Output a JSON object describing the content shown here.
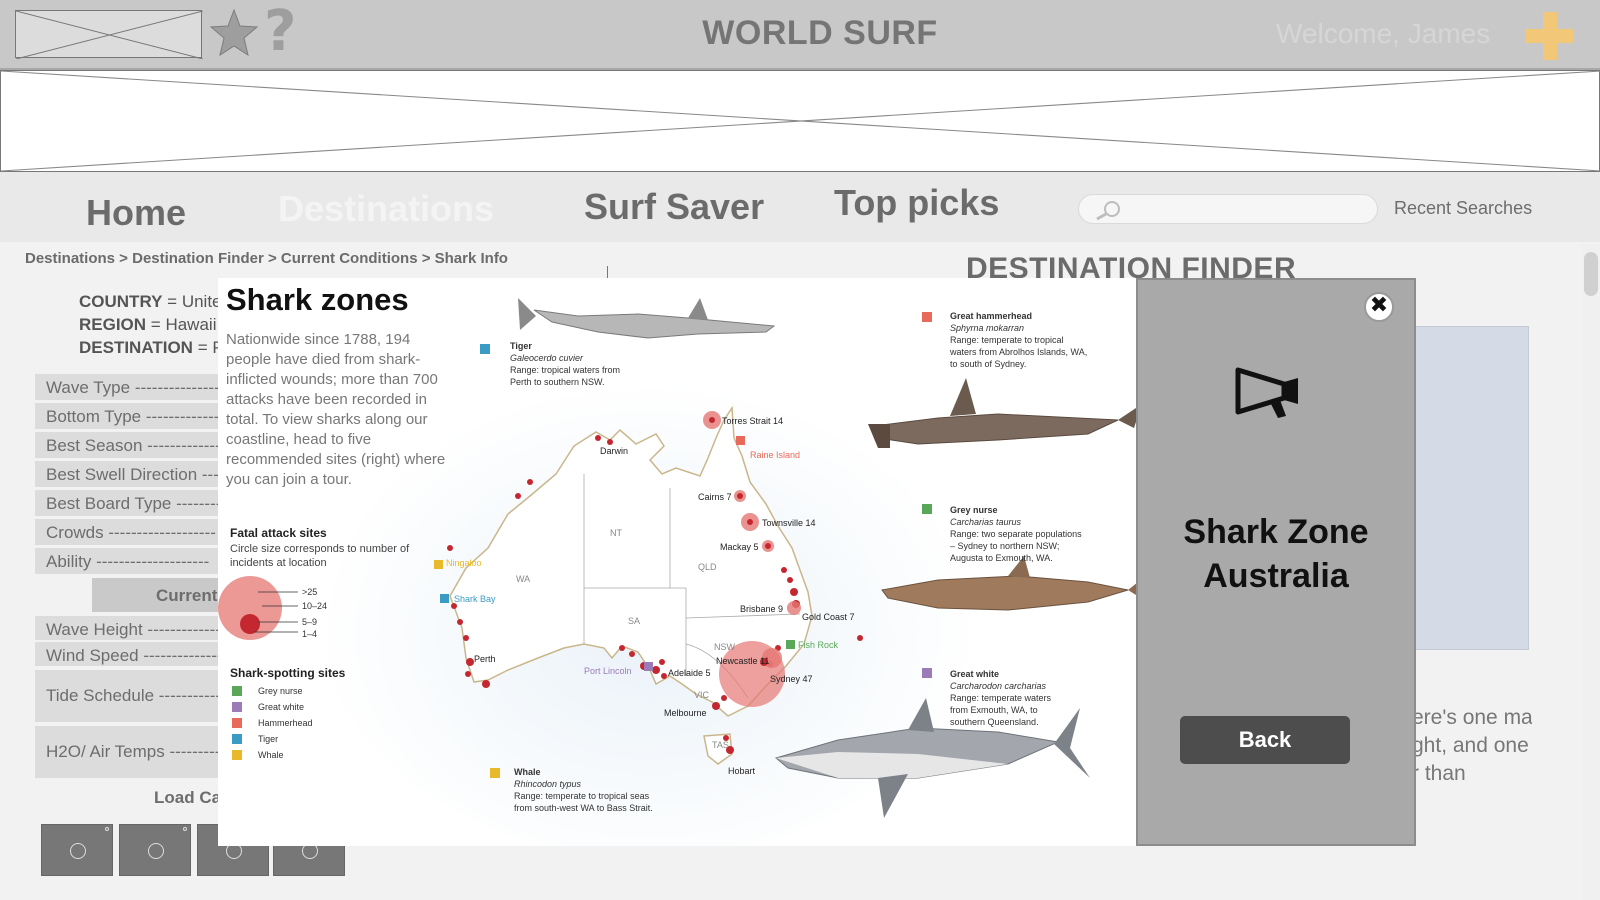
{
  "header": {
    "app_title": "WORLD SURF",
    "welcome": "Welcome,  James"
  },
  "nav": {
    "items": [
      {
        "label": "Home"
      },
      {
        "label": "Destinations"
      },
      {
        "label": "Surf Saver"
      },
      {
        "label": "Top picks"
      }
    ],
    "search_placeholder": "",
    "recent_searches": "Recent Searches"
  },
  "breadcrumb": "Destinations > Destination Finder > Current Conditions > Shark Info",
  "location": {
    "country_label": "COUNTRY",
    "country_value": "= Unite",
    "region_label": "REGION",
    "region_value": "= Hawaii,",
    "destination_label": "DESTINATION",
    "destination_value": "= P"
  },
  "attributes": [
    "Wave Type ------------------",
    "Bottom Type ---------------",
    "Best Season ---------------",
    "Best Swell Direction -----",
    "Best Board Type ----------",
    "Crowds -------------------",
    "Ability --------------------"
  ],
  "current_tab": "Current",
  "conditions": [
    "Wave Height --------------",
    "Wind Speed ---------------",
    "Tide Schedule ------------",
    "H2O/ Air Temps ----------"
  ],
  "load_cams": "Load  Ca",
  "main": {
    "section_title": "DESTINATION FINDER",
    "desc_lines": [
      "ere's one main",
      "ght, and one",
      "r than"
    ]
  },
  "modal": {
    "title_line1": "Shark Zone",
    "title_line2": "Australia",
    "back_label": "Back",
    "close_glyph": "✖"
  },
  "map": {
    "title": "Shark zones",
    "intro": "Nationwide since 1788, 194 people have died from shark-inflicted wounds; more than 700 attacks have been recorded in total. To view sharks along our coastline, head to five recommended sites (right) where you can join a tour.",
    "fatal_heading": "Fatal attack sites",
    "fatal_sub": "Circle size corresponds to number of incidents at location",
    "fatal_scale": [
      ">25",
      "10–24",
      "5–9",
      "1–4"
    ],
    "spotting_heading": "Shark-spotting sites",
    "spotting_legend": [
      {
        "label": "Grey nurse",
        "color": "#5aa75a"
      },
      {
        "label": "Great white",
        "color": "#9b7bb8"
      },
      {
        "label": "Hammerhead",
        "color": "#e86a5a"
      },
      {
        "label": "Tiger",
        "color": "#3a9bc4"
      },
      {
        "label": "Whale",
        "color": "#e8b92a"
      }
    ],
    "species": {
      "tiger": {
        "name": "Tiger",
        "latin": "Galeocerdo cuvier",
        "range1": "Range: tropical waters from",
        "range2": "Perth to southern NSW."
      },
      "hammerhead": {
        "name": "Great hammerhead",
        "latin": "Sphyrna mokarran",
        "range1": "Range: temperate to tropical",
        "range2": "waters from Abrolhos Islands, WA,",
        "range3": "to south of Sydney."
      },
      "greynurse": {
        "name": "Grey nurse",
        "latin": "Carcharias taurus",
        "range1": "Range: two separate populations",
        "range2": "– Sydney to northern NSW;",
        "range3": "Augusta to Exmouth, WA."
      },
      "greatwhite": {
        "name": "Great white",
        "latin": "Carcharodon carcharias",
        "range1": "Range: temperate waters",
        "range2": "from Exmouth, WA, to",
        "range3": "southern Queensland."
      },
      "whale": {
        "name": "Whale",
        "latin": "Rhincodon typus",
        "range1": "Range: temperate to tropical seas",
        "range2": "from south-west WA to Bass Strait."
      }
    },
    "places": {
      "torres": "Torres Strait 14",
      "raine": "Raine Island",
      "darwin": "Darwin",
      "cairns": "Cairns 7",
      "townsville": "Townsville 14",
      "mackay": "Mackay 5",
      "ningaloo": "Ningaloo",
      "sharkbay": "Shark Bay",
      "brisbane": "Brisbane 9",
      "goldcoast": "Gold Coast 7",
      "fishrock": "Fish Rock",
      "newcastle": "Newcastle 11",
      "sydney": "Sydney 47",
      "perth": "Perth",
      "portlincoln": "Port Lincoln",
      "adelaide": "Adelaide 5",
      "melbourne": "Melbourne",
      "hobart": "Hobart",
      "nt": "NT",
      "wa": "WA",
      "qld": "QLD",
      "sa": "SA",
      "nsw": "NSW",
      "vic": "VIC",
      "tas": "TAS"
    }
  }
}
